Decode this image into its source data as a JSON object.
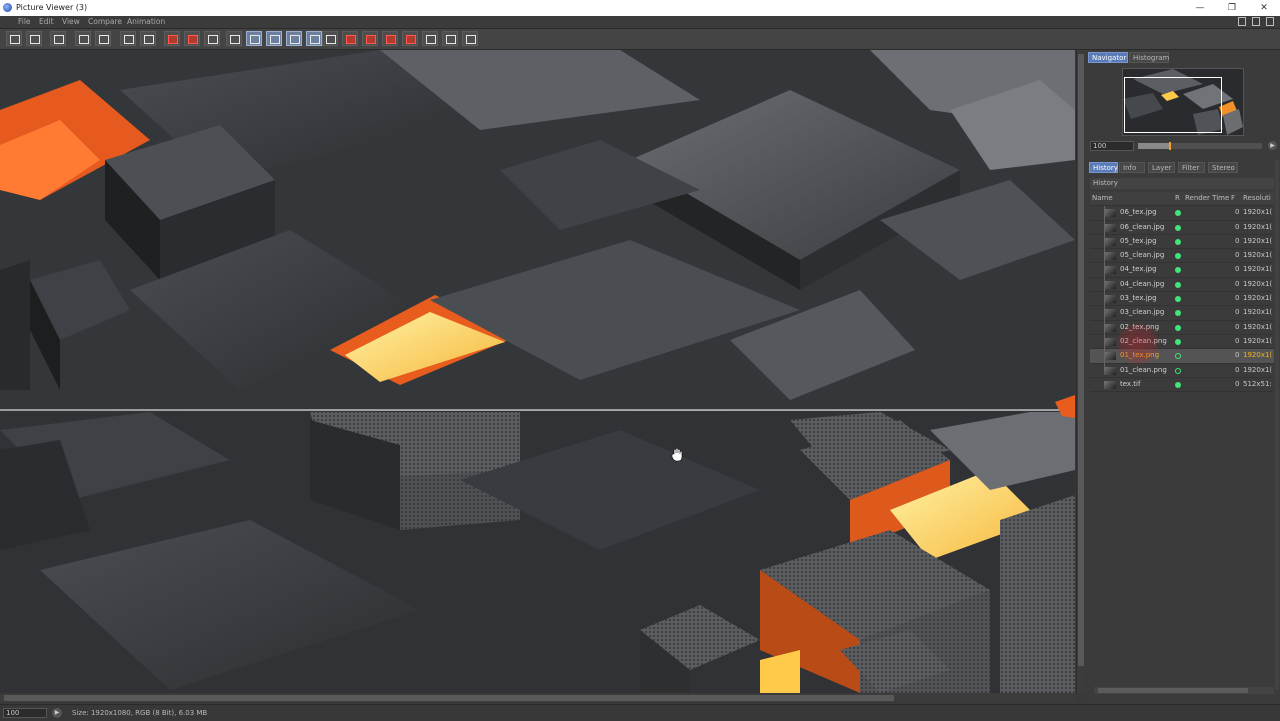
{
  "window": {
    "title": "Picture Viewer (3)",
    "controls": [
      "—",
      "❐",
      "✕"
    ]
  },
  "menu": [
    "File",
    "Edit",
    "View",
    "Compare",
    "Animation"
  ],
  "toolbar": {
    "button_count": 23,
    "active_indices": [
      11,
      12,
      13,
      14
    ],
    "red_indices": [
      7,
      8,
      16,
      17,
      18,
      19
    ]
  },
  "navigator": {
    "tabs": [
      "Navigator",
      "Histogram"
    ],
    "active_tab": "Navigator",
    "zoom_value": "100",
    "zoom_slider_fraction": 0.25
  },
  "panel_tabs": {
    "items": [
      "History",
      "Info",
      "Layer",
      "Filter",
      "Stereo"
    ],
    "active": "History"
  },
  "history": {
    "title": "History",
    "columns": {
      "name": "Name",
      "r": "R",
      "render_time": "Render Time",
      "f": "F",
      "resolution": "Resoluti"
    },
    "rows": [
      {
        "name": "06_tex.jpg",
        "frame": "0",
        "res": "1920x1(",
        "dot": "filled"
      },
      {
        "name": "06_clean.jpg",
        "frame": "0",
        "res": "1920x1(",
        "dot": "filled"
      },
      {
        "name": "05_tex.jpg",
        "frame": "0",
        "res": "1920x1(",
        "dot": "filled"
      },
      {
        "name": "05_clean.jpg",
        "frame": "0",
        "res": "1920x1(",
        "dot": "filled"
      },
      {
        "name": "04_tex.jpg",
        "frame": "0",
        "res": "1920x1(",
        "dot": "filled"
      },
      {
        "name": "04_clean.jpg",
        "frame": "0",
        "res": "1920x1(",
        "dot": "filled"
      },
      {
        "name": "03_tex.jpg",
        "frame": "0",
        "res": "1920x1(",
        "dot": "filled"
      },
      {
        "name": "03_clean.jpg",
        "frame": "0",
        "res": "1920x1(",
        "dot": "filled"
      },
      {
        "name": "02_tex.png",
        "frame": "0",
        "res": "1920x1(",
        "dot": "filled"
      },
      {
        "name": "02_clean.png",
        "frame": "0",
        "res": "1920x1(",
        "dot": "filled"
      },
      {
        "name": "01_tex.png",
        "frame": "0",
        "res": "1920x1(",
        "dot": "ring",
        "selected": true
      },
      {
        "name": "01_clean.png",
        "frame": "0",
        "res": "1920x1(",
        "dot": "ring"
      },
      {
        "name": "tex.tif",
        "frame": "0",
        "res": "512x51:",
        "dot": "filled"
      }
    ]
  },
  "status": {
    "zoom": "100",
    "info": "Size: 1920x1080, RGB (8 Bit), 6.03 MB"
  },
  "colors": {
    "accent": "#5a7bb7",
    "status_dot": "#41e57a",
    "selected_text": "#f4b223",
    "glow": "#ffc94a"
  }
}
